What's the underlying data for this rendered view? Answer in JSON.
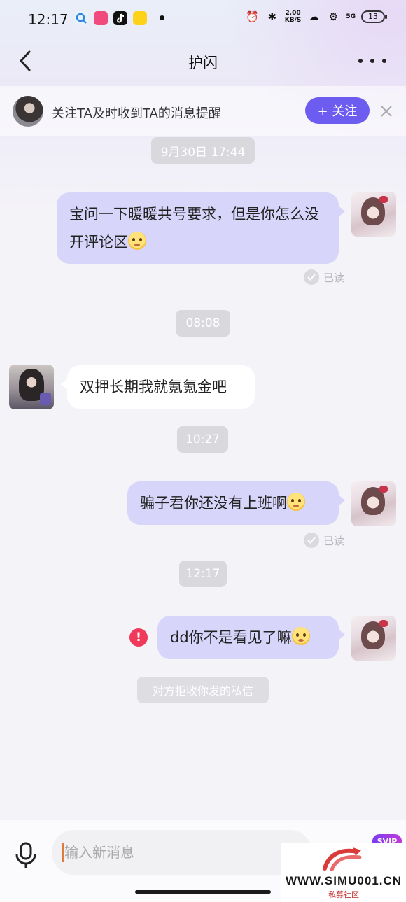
{
  "status_bar": {
    "time": "12:17",
    "net_speed_value": "2.00",
    "net_speed_unit": "KB/S",
    "network": "5G",
    "battery": "13"
  },
  "header": {
    "title": "护闪"
  },
  "follow_banner": {
    "text": "关注TA及时收到TA的消息提醒",
    "follow_button": "+ 关注"
  },
  "messages": [
    {
      "type": "timestamp",
      "text": "9月30日 17:44"
    },
    {
      "type": "outgoing",
      "text": "宝问一下暖暖共号要求，但是你怎么没开评论区",
      "emoji": "thinking-face",
      "read_status": "已读"
    },
    {
      "type": "timestamp",
      "text": "08:08"
    },
    {
      "type": "incoming",
      "text": "双押长期我就氪氪金吧"
    },
    {
      "type": "timestamp",
      "text": "10:27"
    },
    {
      "type": "outgoing",
      "text": "骗子君你还没有上班啊",
      "emoji": "thinking-face",
      "read_status": "已读"
    },
    {
      "type": "timestamp",
      "text": "12:17"
    },
    {
      "type": "outgoing",
      "text": "dd你不是看见了嘛",
      "emoji": "pleading-face",
      "failed": true
    },
    {
      "type": "system",
      "text": "对方拒收你发的私信"
    }
  ],
  "composer": {
    "placeholder": "输入新消息",
    "badge": "SVIP"
  },
  "watermark": {
    "url": "WWW.SIMU001.CN",
    "subtitle": "私募社区"
  },
  "colors": {
    "accent": "#6d5cf0",
    "outgoing_bubble": "#d8d5fb",
    "error": "#f03a5c"
  }
}
